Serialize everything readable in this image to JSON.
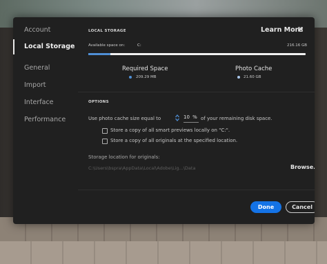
{
  "sidebar": {
    "items": [
      {
        "label": "Account"
      },
      {
        "label": "Local Storage",
        "active": true
      },
      {
        "label": "General"
      },
      {
        "label": "Import"
      },
      {
        "label": "Interface"
      },
      {
        "label": "Performance"
      }
    ]
  },
  "storage": {
    "section_title": "LOCAL STORAGE",
    "learn_more": "Learn More",
    "available_label": "Available space on:",
    "drive": "C:",
    "available_value": "216.16 GB",
    "usage_fraction": 0.1,
    "required_label": "Required Space",
    "required_value": "209.29 MB",
    "cache_label": "Photo Cache",
    "cache_value": "21.60 GB"
  },
  "options": {
    "section_title": "OPTIONS",
    "cache_prefix": "Use photo cache size equal to",
    "cache_percent": "10",
    "percent_sign": "%",
    "cache_suffix": "of your remaining disk space.",
    "smart_previews_label": "Store a copy of all smart previews locally on \"C:\".",
    "smart_previews_checked": false,
    "originals_label": "Store a copy of all originals at the specified location.",
    "originals_checked": false,
    "storage_location_label": "Storage location for originals:",
    "storage_path": "C:\\Users\\bspra\\AppData\\Local\\Adobe\\Lig...\\Data",
    "browse_label": "Browse..."
  },
  "footer": {
    "done_label": "Done",
    "cancel_label": "Cancel"
  },
  "colors": {
    "accent": "#1473e6",
    "required_dot": "#4f8fd6",
    "cache_dot": "#a9c6ea"
  },
  "icons": {
    "learn_more": "external-link-icon",
    "stepper": "stepper-arrows-icon"
  }
}
